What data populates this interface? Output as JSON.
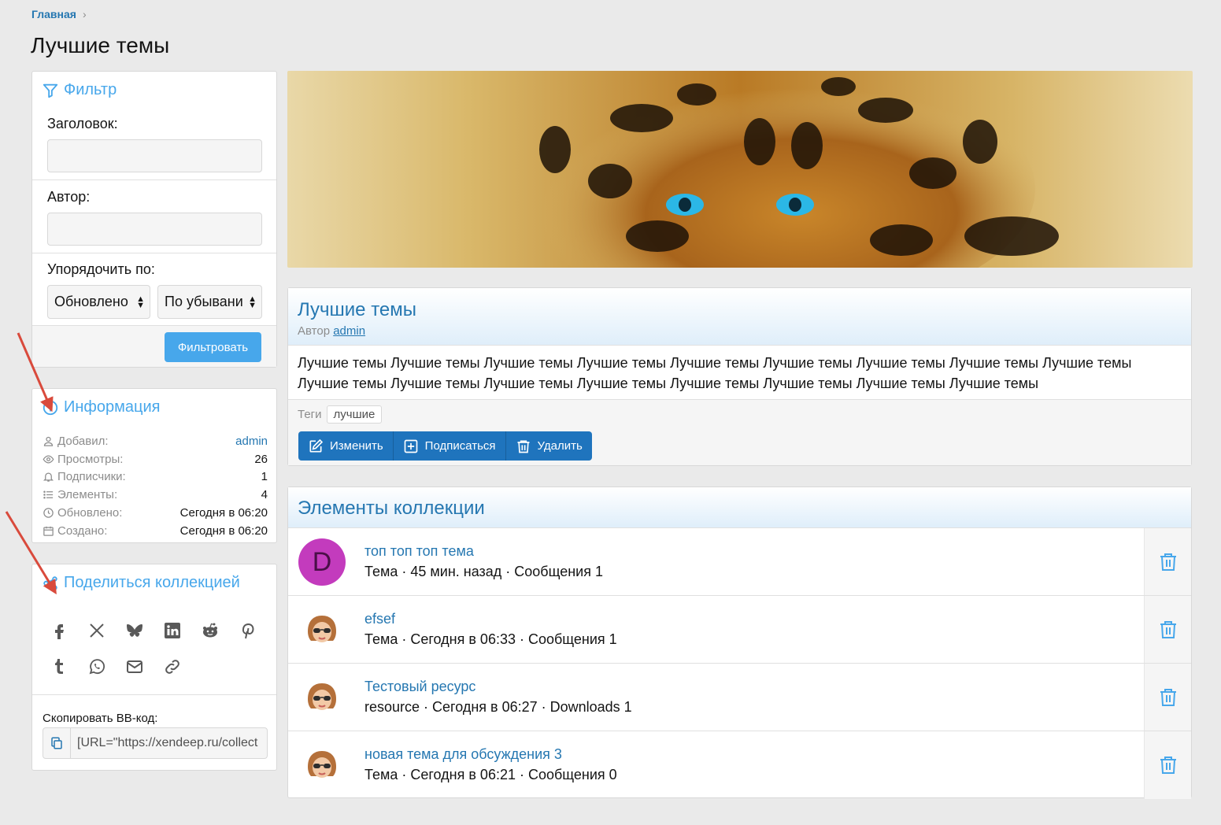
{
  "breadcrumb": {
    "home": "Главная"
  },
  "page": {
    "title": "Лучшие темы"
  },
  "filter": {
    "title": "Фильтр",
    "title_label": "Заголовок:",
    "author_label": "Автор:",
    "sort_label": "Упорядочить по:",
    "sort_field": "Обновлено",
    "sort_order": "По убывани",
    "submit": "Фильтровать"
  },
  "info": {
    "title": "Информация",
    "rows": [
      {
        "key": "Добавил:",
        "value": "admin"
      },
      {
        "key": "Просмотры:",
        "value": "26"
      },
      {
        "key": "Подписчики:",
        "value": "1"
      },
      {
        "key": "Элементы:",
        "value": "4"
      },
      {
        "key": "Обновлено:",
        "value": "Сегодня в 06:20"
      },
      {
        "key": "Создано:",
        "value": "Сегодня в 06:20"
      }
    ]
  },
  "share": {
    "title": "Поделиться коллекцией",
    "icons": [
      "facebook-icon",
      "x-icon",
      "bluesky-icon",
      "linkedin-icon",
      "reddit-icon",
      "pinterest-icon",
      "tumblr-icon",
      "whatsapp-icon",
      "email-icon",
      "link-icon"
    ],
    "bb_label": "Скопировать BB-код:",
    "bb_value": "[URL=\"https://xendeep.ru/collect"
  },
  "collection": {
    "title": "Лучшие темы",
    "author_prefix": "Автор",
    "author": "admin",
    "description": "Лучшие темы Лучшие темы Лучшие темы Лучшие темы Лучшие темы Лучшие темы Лучшие темы Лучшие темы Лучшие темы Лучшие темы Лучшие темы Лучшие темы Лучшие темы Лучшие темы Лучшие темы Лучшие темы Лучшие темы",
    "tags_label": "Теги",
    "tags": [
      "лучшие"
    ],
    "buttons": {
      "edit": "Изменить",
      "subscribe": "Подписаться",
      "delete": "Удалить"
    }
  },
  "items": {
    "title": "Элементы коллекции",
    "list": [
      {
        "title": "топ топ топ тема",
        "meta": "Тема · 45 мин. назад · Сообщения 1",
        "avatar_letter": "D"
      },
      {
        "title": "efsef",
        "meta": "Тема · Сегодня в 06:33 · Сообщения 1",
        "avatar_letter": ""
      },
      {
        "title": "Тестовый ресурс",
        "meta": "resource · Сегодня в 06:27 · Downloads 1",
        "avatar_letter": ""
      },
      {
        "title": "новая тема для обсуждения 3",
        "meta": "Тема · Сегодня в 06:21 · Сообщения 0",
        "avatar_letter": ""
      }
    ]
  },
  "colors": {
    "link": "#2577b1",
    "accent": "#47a7eb",
    "button": "#1f74bd",
    "avatar_d": "#c33bbd",
    "arrow": "#d94a3c"
  }
}
